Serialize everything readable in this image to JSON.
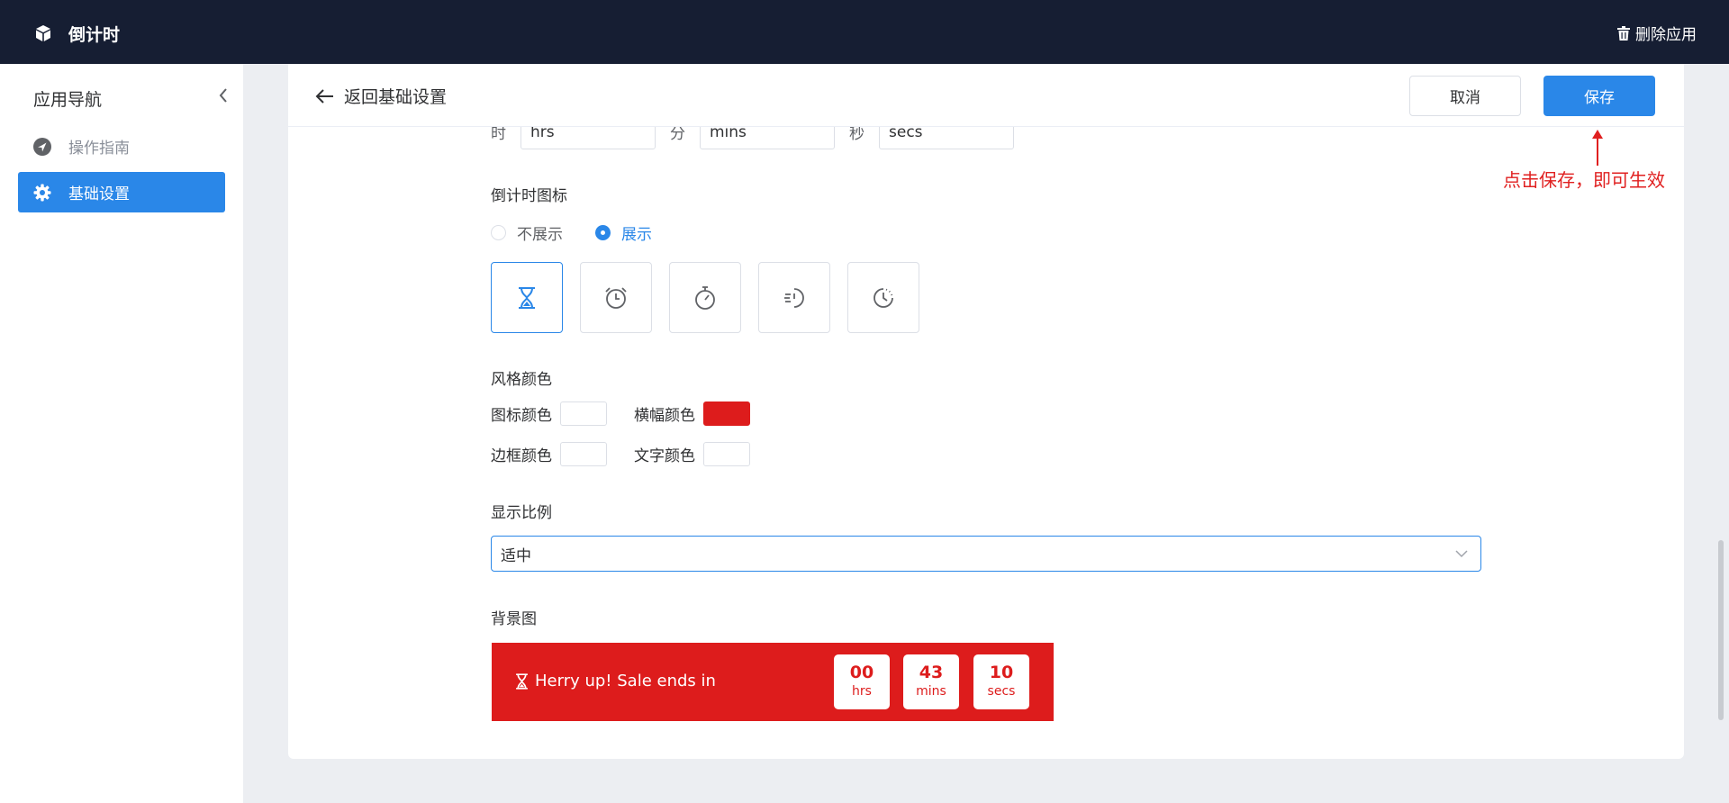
{
  "topbar": {
    "app_title": "倒计时",
    "delete_label": "删除应用",
    "logo_icon": "cube-icon",
    "delete_icon": "trash-icon"
  },
  "sidebar": {
    "title": "应用导航",
    "items": [
      {
        "label": "操作指南",
        "icon": "navigation-icon",
        "active": false
      },
      {
        "label": "基础设置",
        "icon": "gear-icon",
        "active": true
      }
    ]
  },
  "header": {
    "back_label": "返回基础设置",
    "cancel_label": "取消",
    "save_label": "保存"
  },
  "time_fields": [
    {
      "label": "时",
      "value": "hrs"
    },
    {
      "label": "分",
      "value": "mins"
    },
    {
      "label": "秒",
      "value": "secs"
    }
  ],
  "countdown_icon": {
    "label": "倒计时图标",
    "options": [
      {
        "label": "不展示",
        "checked": false
      },
      {
        "label": "展示",
        "checked": true
      }
    ],
    "icons": [
      "hourglass-icon",
      "alarm-clock-icon",
      "stopwatch-icon",
      "fast-timer-icon",
      "clock-icon"
    ],
    "selected_index": 0
  },
  "style_colors": {
    "label": "风格颜色",
    "icon_color": {
      "label": "图标颜色",
      "value": "#ffffff"
    },
    "banner_color": {
      "label": "横幅颜色",
      "value": "#dd1c1c"
    },
    "border_color": {
      "label": "边框颜色",
      "value": "#ffffff"
    },
    "text_color": {
      "label": "文字颜色",
      "value": "#ffffff"
    }
  },
  "display_ratio": {
    "label": "显示比例",
    "value": "适中"
  },
  "background": {
    "label": "背景图",
    "message": "Herry up!  Sale ends in",
    "timer": [
      {
        "num": "00",
        "unit": "hrs"
      },
      {
        "num": "43",
        "unit": "mins"
      },
      {
        "num": "10",
        "unit": "secs"
      }
    ]
  },
  "annotation": {
    "text": "点击保存，即可生效",
    "color": "#e02020"
  },
  "colors": {
    "accent": "#2a87e8",
    "topbar": "#161e33",
    "banner": "#dd1c1c"
  }
}
